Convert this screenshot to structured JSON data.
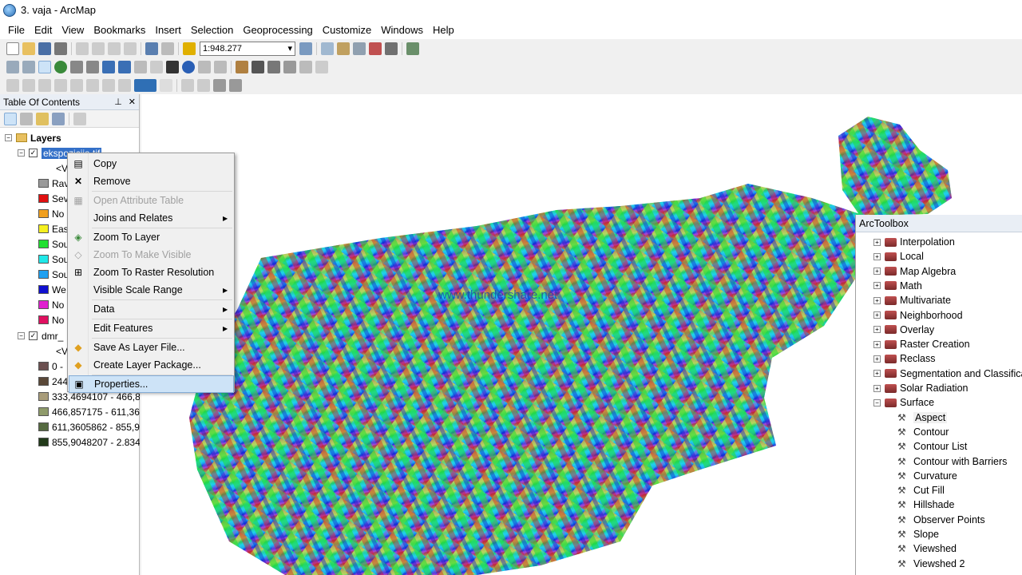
{
  "window": {
    "title": "3. vaja - ArcMap"
  },
  "menu": [
    "File",
    "Edit",
    "View",
    "Bookmarks",
    "Insert",
    "Selection",
    "Geoprocessing",
    "Customize",
    "Windows",
    "Help"
  ],
  "toolbar": {
    "scale_value": "1:948.277"
  },
  "toc": {
    "title": "Table Of Contents",
    "root": "Layers",
    "layer1": {
      "name": "ekspozicija.tif",
      "value_label": "<V",
      "classes": [
        {
          "label": "Rav",
          "color": "#9a9a9a"
        },
        {
          "label": "Sev",
          "color": "#e01010"
        },
        {
          "label": "No",
          "color": "#f0a020"
        },
        {
          "label": "Eas",
          "color": "#f5f020"
        },
        {
          "label": "Sou",
          "color": "#20e030"
        },
        {
          "label": "Sou",
          "color": "#20e8e8"
        },
        {
          "label": "Sou",
          "color": "#20a0f0"
        },
        {
          "label": "We",
          "color": "#1010d0"
        },
        {
          "label": "No",
          "color": "#e020d0"
        },
        {
          "label": "No",
          "color": "#e01060"
        }
      ]
    },
    "layer2": {
      "name": "dmr_",
      "value_label": "<V",
      "classes": [
        {
          "label": "0 -",
          "color": "#6b4f4f"
        },
        {
          "label": "244",
          "color": "#5a4838"
        },
        {
          "label": "333,4694107 - 466,8",
          "color": "#a89c7a"
        },
        {
          "label": "466,857175 - 611,36",
          "color": "#8e9a6a"
        },
        {
          "label": "611,3605862 - 855,9",
          "color": "#556a40"
        },
        {
          "label": "855,9048207 - 2.834",
          "color": "#223a1a"
        }
      ]
    }
  },
  "context_menu": [
    {
      "label": "Copy",
      "icon": "copy-icon",
      "glyph": "▤",
      "disabled": false,
      "submenu": false,
      "selected": false,
      "sep_after": false
    },
    {
      "label": "Remove",
      "icon": "remove-icon",
      "glyph": "✕",
      "disabled": false,
      "submenu": false,
      "selected": false,
      "sep_after": true
    },
    {
      "label": "Open Attribute Table",
      "icon": "table-icon",
      "glyph": "▦",
      "disabled": true,
      "submenu": false,
      "selected": false,
      "sep_after": false
    },
    {
      "label": "Joins and Relates",
      "icon": "",
      "glyph": "",
      "disabled": false,
      "submenu": true,
      "selected": false,
      "sep_after": true
    },
    {
      "label": "Zoom To Layer",
      "icon": "zoom-to-layer-icon",
      "glyph": "◈",
      "disabled": false,
      "submenu": false,
      "selected": false,
      "sep_after": false
    },
    {
      "label": "Zoom To Make Visible",
      "icon": "zoom-visible-icon",
      "glyph": "◇",
      "disabled": true,
      "submenu": false,
      "selected": false,
      "sep_after": false
    },
    {
      "label": "Zoom To Raster Resolution",
      "icon": "raster-resolution-icon",
      "glyph": "⊞",
      "disabled": false,
      "submenu": false,
      "selected": false,
      "sep_after": false
    },
    {
      "label": "Visible Scale Range",
      "icon": "",
      "glyph": "",
      "disabled": false,
      "submenu": true,
      "selected": false,
      "sep_after": true
    },
    {
      "label": "Data",
      "icon": "",
      "glyph": "",
      "disabled": false,
      "submenu": true,
      "selected": false,
      "sep_after": true
    },
    {
      "label": "Edit Features",
      "icon": "",
      "glyph": "",
      "disabled": false,
      "submenu": true,
      "selected": false,
      "sep_after": true
    },
    {
      "label": "Save As Layer File...",
      "icon": "layer-file-icon",
      "glyph": "◆",
      "disabled": false,
      "submenu": false,
      "selected": false,
      "sep_after": false
    },
    {
      "label": "Create Layer Package...",
      "icon": "layer-package-icon",
      "glyph": "◆",
      "disabled": false,
      "submenu": false,
      "selected": false,
      "sep_after": true
    },
    {
      "label": "Properties...",
      "icon": "properties-icon",
      "glyph": "▣",
      "disabled": false,
      "submenu": false,
      "selected": true,
      "sep_after": false
    }
  ],
  "map": {
    "watermark": "www.thundershare.net"
  },
  "arctoolbox": {
    "title": "ArcToolbox",
    "toolsets": [
      "Interpolation",
      "Local",
      "Map Algebra",
      "Math",
      "Multivariate",
      "Neighborhood",
      "Overlay",
      "Raster Creation",
      "Reclass",
      "Segmentation and Classification",
      "Solar Radiation"
    ],
    "open_toolset": "Surface",
    "tools": [
      "Aspect",
      "Contour",
      "Contour List",
      "Contour with Barriers",
      "Curvature",
      "Cut Fill",
      "Hillshade",
      "Observer Points",
      "Slope",
      "Viewshed",
      "Viewshed 2"
    ],
    "selected_tool": "Aspect"
  }
}
